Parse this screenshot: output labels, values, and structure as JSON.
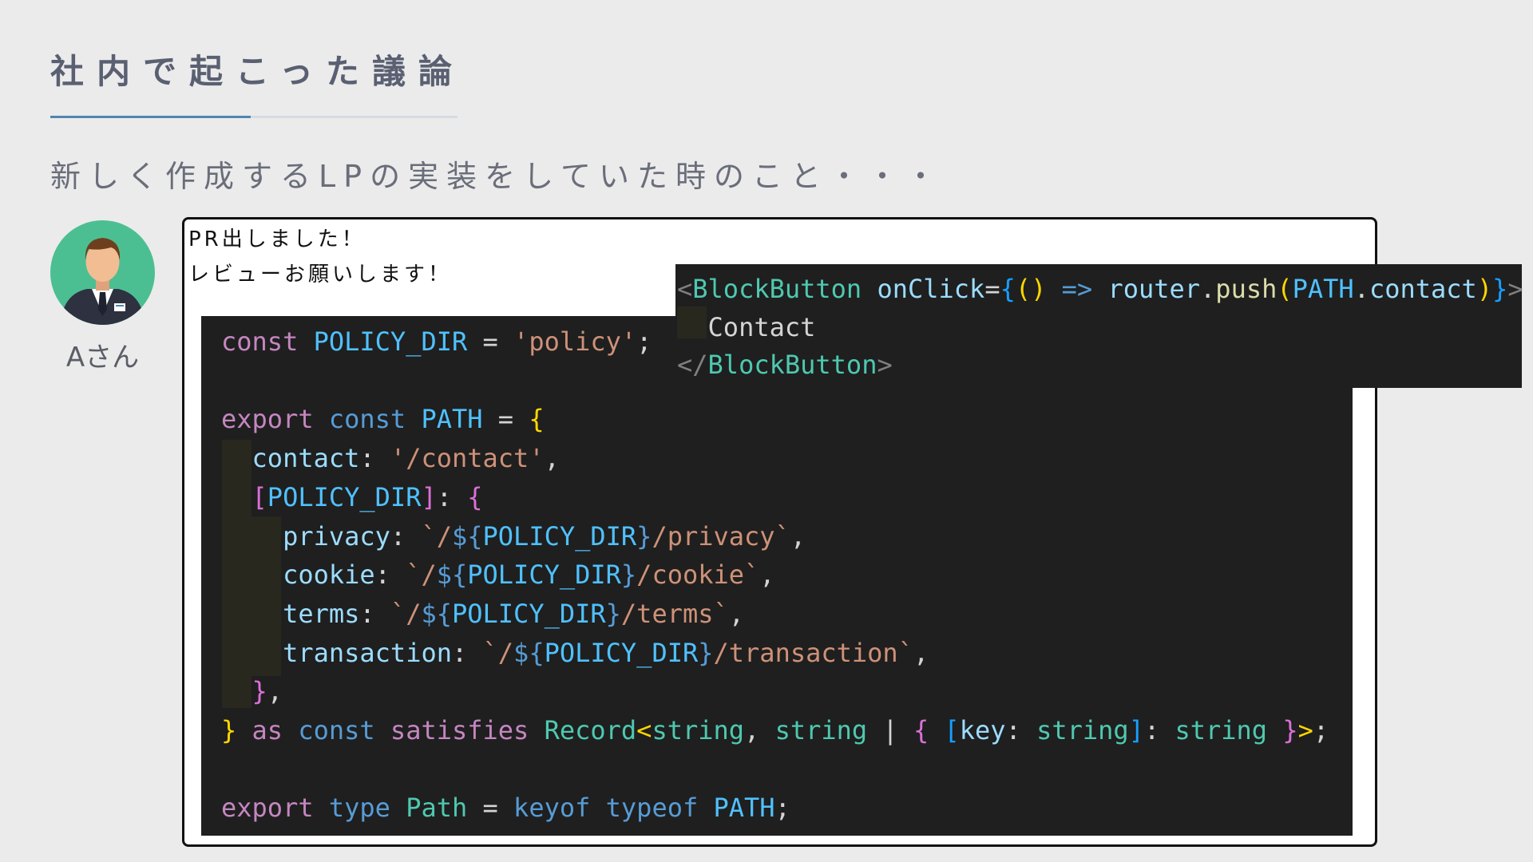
{
  "slide": {
    "title": "社内で起こった議論",
    "subtitle": "新しく作成するLPの実装をしていた時のこと・・・"
  },
  "user": {
    "name": "Aさん"
  },
  "message": {
    "line1": "PR出しました！",
    "line2": "レビューお願いします！"
  },
  "code_main": [
    [
      [
        "k",
        "const"
      ],
      [
        "p",
        " "
      ],
      [
        "n",
        "POLICY_DIR"
      ],
      [
        "p",
        " = "
      ],
      [
        "s",
        "'policy'"
      ],
      [
        "p",
        ";"
      ]
    ],
    [],
    [
      [
        "k",
        "export"
      ],
      [
        "p",
        " "
      ],
      [
        "kb",
        "const"
      ],
      [
        "p",
        " "
      ],
      [
        "n",
        "PATH"
      ],
      [
        "p",
        " = "
      ],
      [
        "b1",
        "{"
      ]
    ],
    [
      [
        "p",
        "  "
      ],
      [
        "v",
        "contact"
      ],
      [
        "p",
        ": "
      ],
      [
        "s",
        "'/contact'"
      ],
      [
        "p",
        ","
      ]
    ],
    [
      [
        "p",
        "  "
      ],
      [
        "b2",
        "["
      ],
      [
        "n",
        "POLICY_DIR"
      ],
      [
        "b2",
        "]"
      ],
      [
        "p",
        ": "
      ],
      [
        "b2",
        "{"
      ]
    ],
    [
      [
        "p",
        "    "
      ],
      [
        "v",
        "privacy"
      ],
      [
        "p",
        ": "
      ],
      [
        "s",
        "`/"
      ],
      [
        "kb",
        "${"
      ],
      [
        "n",
        "POLICY_DIR"
      ],
      [
        "kb",
        "}"
      ],
      [
        "s",
        "/privacy`"
      ],
      [
        "p",
        ","
      ]
    ],
    [
      [
        "p",
        "    "
      ],
      [
        "v",
        "cookie"
      ],
      [
        "p",
        ": "
      ],
      [
        "s",
        "`/"
      ],
      [
        "kb",
        "${"
      ],
      [
        "n",
        "POLICY_DIR"
      ],
      [
        "kb",
        "}"
      ],
      [
        "s",
        "/cookie`"
      ],
      [
        "p",
        ","
      ]
    ],
    [
      [
        "p",
        "    "
      ],
      [
        "v",
        "terms"
      ],
      [
        "p",
        ": "
      ],
      [
        "s",
        "`/"
      ],
      [
        "kb",
        "${"
      ],
      [
        "n",
        "POLICY_DIR"
      ],
      [
        "kb",
        "}"
      ],
      [
        "s",
        "/terms`"
      ],
      [
        "p",
        ","
      ]
    ],
    [
      [
        "p",
        "    "
      ],
      [
        "v",
        "transaction"
      ],
      [
        "p",
        ": "
      ],
      [
        "s",
        "`/"
      ],
      [
        "kb",
        "${"
      ],
      [
        "n",
        "POLICY_DIR"
      ],
      [
        "kb",
        "}"
      ],
      [
        "s",
        "/transaction`"
      ],
      [
        "p",
        ","
      ]
    ],
    [
      [
        "p",
        "  "
      ],
      [
        "b2",
        "}"
      ],
      [
        "p",
        ","
      ]
    ],
    [
      [
        "b1",
        "}"
      ],
      [
        "p",
        " "
      ],
      [
        "k",
        "as"
      ],
      [
        "p",
        " "
      ],
      [
        "kb",
        "const"
      ],
      [
        "p",
        " "
      ],
      [
        "k",
        "satisfies"
      ],
      [
        "p",
        " "
      ],
      [
        "t",
        "Record"
      ],
      [
        "b1",
        "<"
      ],
      [
        "t",
        "string"
      ],
      [
        "p",
        ", "
      ],
      [
        "t",
        "string"
      ],
      [
        "p",
        " | "
      ],
      [
        "b2",
        "{"
      ],
      [
        "p",
        " "
      ],
      [
        "b3",
        "["
      ],
      [
        "v",
        "key"
      ],
      [
        "p",
        ": "
      ],
      [
        "t",
        "string"
      ],
      [
        "b3",
        "]"
      ],
      [
        "p",
        ": "
      ],
      [
        "t",
        "string"
      ],
      [
        "p",
        " "
      ],
      [
        "b2",
        "}"
      ],
      [
        "b1",
        ">"
      ],
      [
        "p",
        ";"
      ]
    ],
    [],
    [
      [
        "k",
        "export"
      ],
      [
        "p",
        " "
      ],
      [
        "kb",
        "type"
      ],
      [
        "p",
        " "
      ],
      [
        "t",
        "Path"
      ],
      [
        "p",
        " = "
      ],
      [
        "kb",
        "keyof"
      ],
      [
        "p",
        " "
      ],
      [
        "kb",
        "typeof"
      ],
      [
        "p",
        " "
      ],
      [
        "n",
        "PATH"
      ],
      [
        "p",
        ";"
      ]
    ]
  ],
  "code_popup": [
    [
      [
        "g",
        "<"
      ],
      [
        "t",
        "BlockButton"
      ],
      [
        "p",
        " "
      ],
      [
        "v",
        "onClick"
      ],
      [
        "p",
        "="
      ],
      [
        "b3",
        "{"
      ],
      [
        "b1",
        "()"
      ],
      [
        "p",
        " "
      ],
      [
        "kb",
        "=>"
      ],
      [
        "p",
        " "
      ],
      [
        "v",
        "router"
      ],
      [
        "p",
        "."
      ],
      [
        "f",
        "push"
      ],
      [
        "b1",
        "("
      ],
      [
        "n",
        "PATH"
      ],
      [
        "p",
        "."
      ],
      [
        "v",
        "contact"
      ],
      [
        "b1",
        ")"
      ],
      [
        "b3",
        "}"
      ],
      [
        "g",
        ">"
      ]
    ],
    [
      [
        "p",
        "  Contact"
      ]
    ],
    [
      [
        "g",
        "</"
      ],
      [
        "t",
        "BlockButton"
      ],
      [
        "g",
        ">"
      ]
    ]
  ]
}
